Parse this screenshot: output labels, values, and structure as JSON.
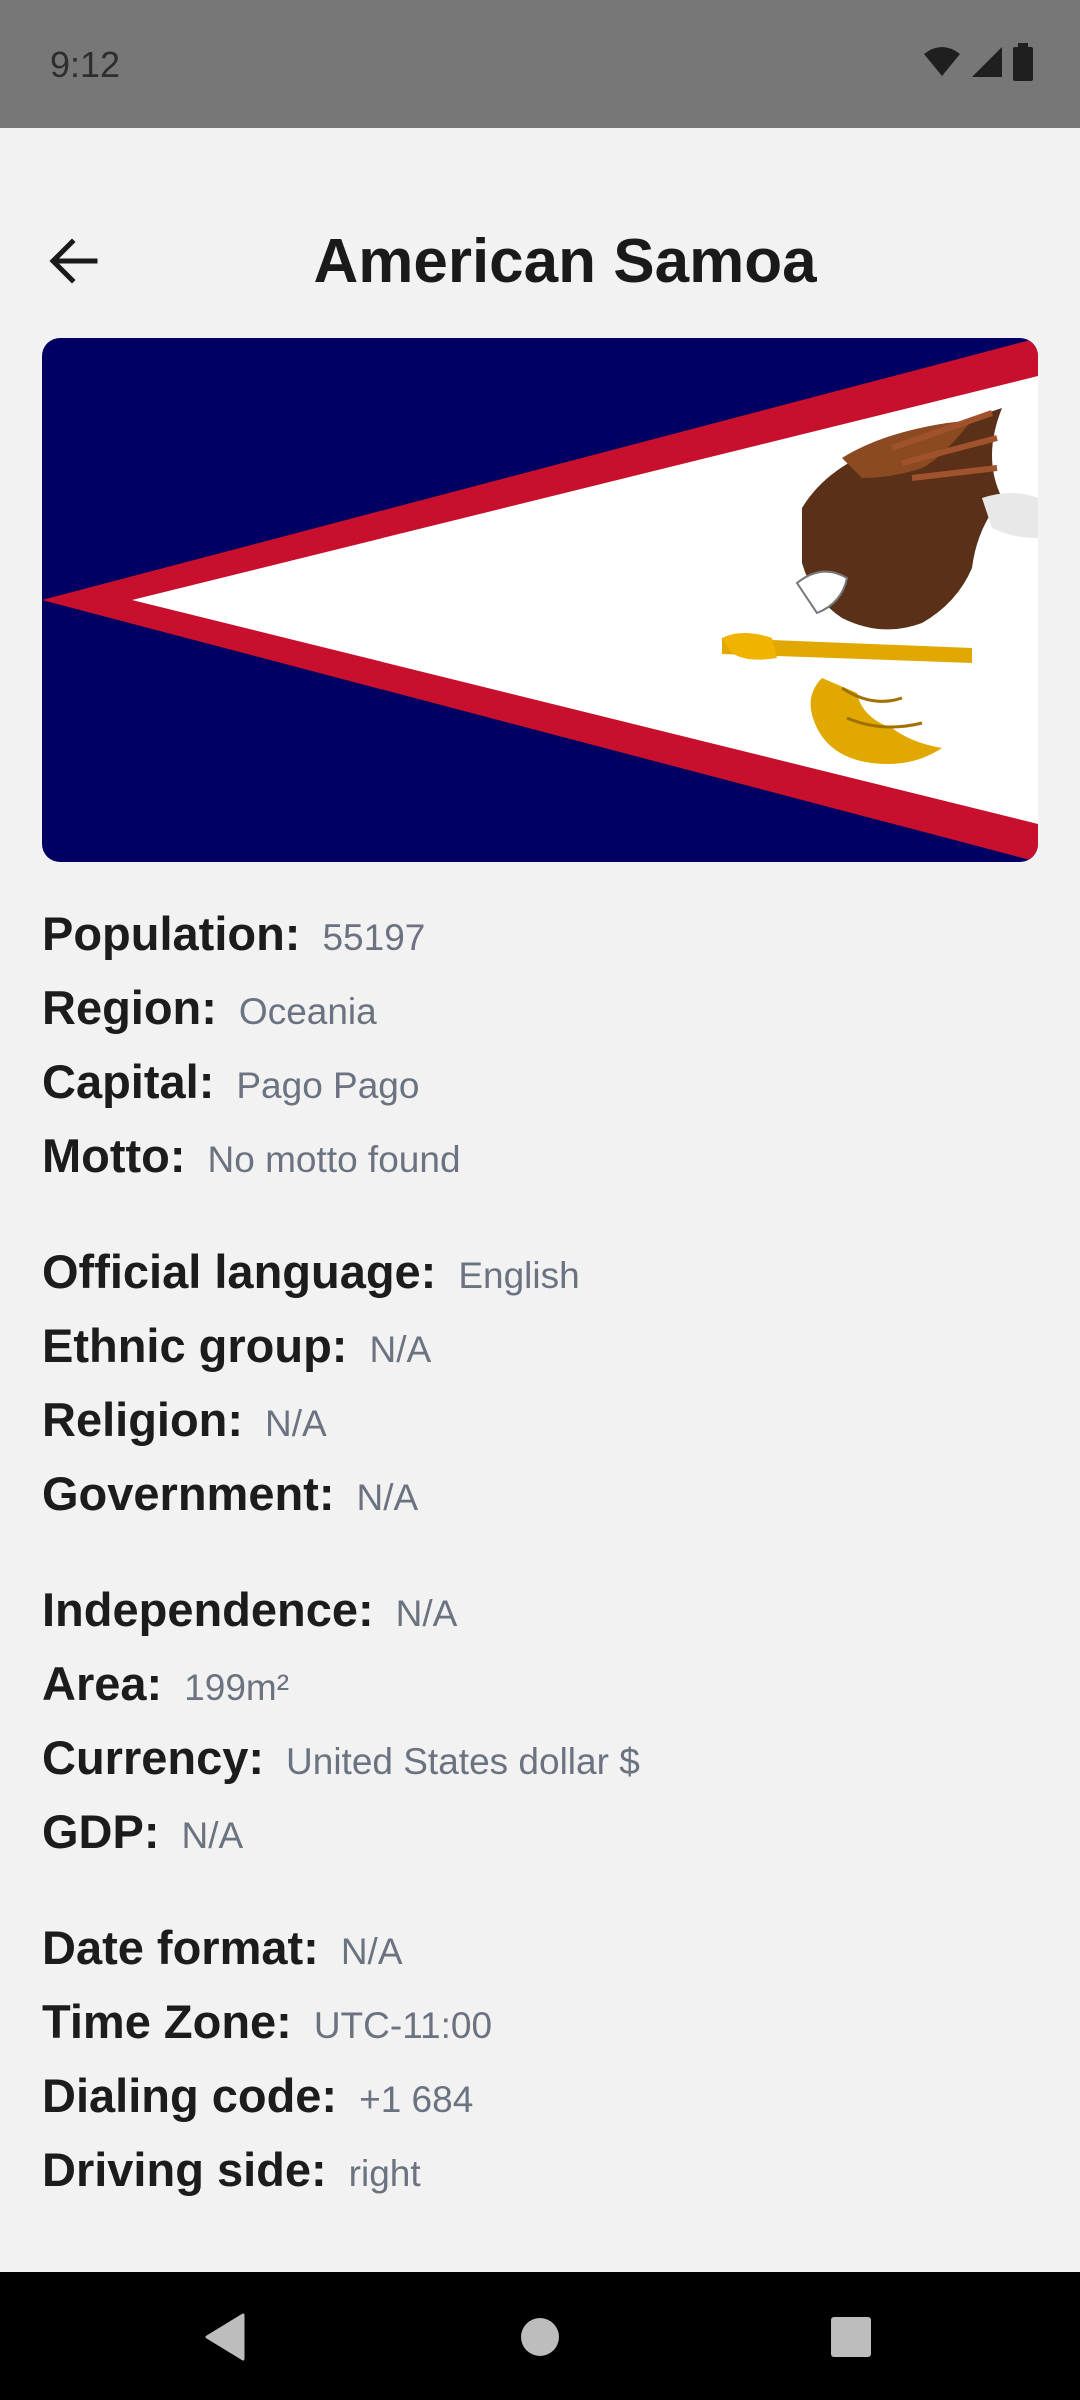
{
  "status_bar": {
    "time": "9:12",
    "icons": [
      "wifi-icon",
      "cell-signal-icon",
      "battery-icon"
    ]
  },
  "header": {
    "title": "American Samoa",
    "back_icon": "arrow-left-icon"
  },
  "flag": {
    "icon": "american-samoa-flag",
    "colors": {
      "blue": "#000063",
      "red": "#c8102e",
      "white": "#ffffff",
      "eagle_brown": "#6b3a1e",
      "gold": "#f0b400"
    }
  },
  "details": {
    "group1": [
      {
        "label": "Population:",
        "value": "55197"
      },
      {
        "label": "Region:",
        "value": "Oceania"
      },
      {
        "label": "Capital:",
        "value": "Pago Pago"
      },
      {
        "label": "Motto:",
        "value": "No motto found"
      }
    ],
    "group2": [
      {
        "label": "Official language:",
        "value": "English"
      },
      {
        "label": "Ethnic group:",
        "value": "N/A"
      },
      {
        "label": "Religion:",
        "value": "N/A"
      },
      {
        "label": "Government:",
        "value": "N/A"
      }
    ],
    "group3": [
      {
        "label": "Independence:",
        "value": "N/A"
      },
      {
        "label": "Area:",
        "value": "199m²"
      },
      {
        "label": "Currency:",
        "value": "United States dollar $"
      },
      {
        "label": "GDP:",
        "value": "N/A"
      }
    ],
    "group4": [
      {
        "label": "Date format:",
        "value": "N/A"
      },
      {
        "label": "Time Zone:",
        "value": "UTC-11:00"
      },
      {
        "label": "Dialing code:",
        "value": "+1 684"
      },
      {
        "label": "Driving side:",
        "value": "right"
      }
    ]
  },
  "nav_bar": {
    "buttons": [
      "back-triangle-icon",
      "home-circle-icon",
      "recents-square-icon"
    ]
  }
}
